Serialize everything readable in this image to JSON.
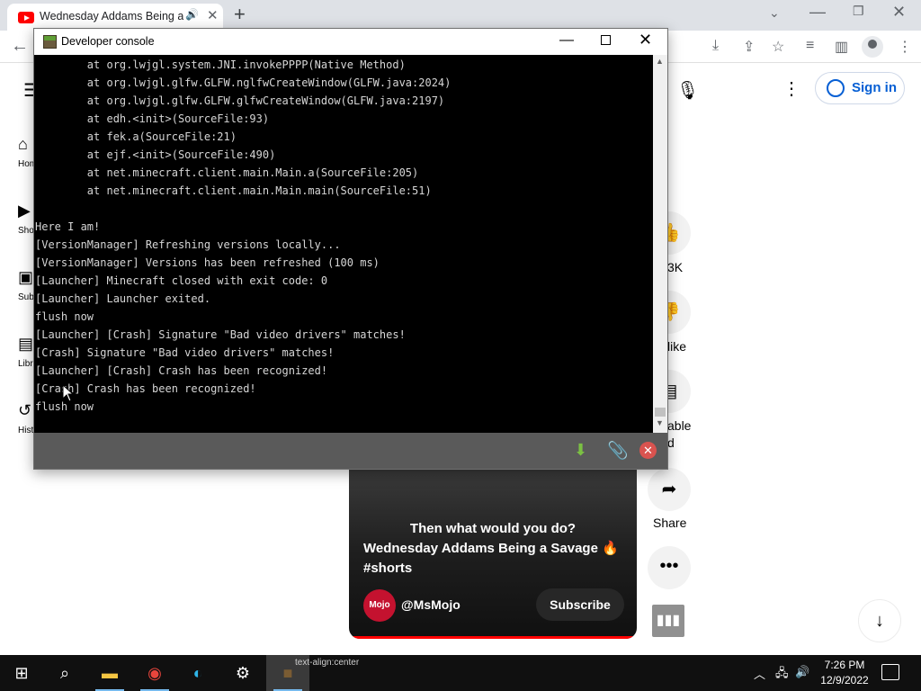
{
  "browser": {
    "tab_title": "Wednesday Addams Being a Savage",
    "new_tab_icon": "plus-icon"
  },
  "youtube": {
    "sign_in": "Sign in",
    "sidebar": [
      {
        "label": "Home",
        "icon": "home-icon"
      },
      {
        "label": "Shorts",
        "icon": "shorts-icon"
      },
      {
        "label": "Subscriptions",
        "icon": "subscriptions-icon"
      },
      {
        "label": "Library",
        "icon": "library-icon"
      },
      {
        "label": "History",
        "icon": "history-icon"
      }
    ],
    "actions": {
      "like_count": "3K",
      "dislike_label": "like",
      "disable_label": "able",
      "disable_sub": "d",
      "share_label": "Share"
    },
    "short": {
      "caption": "Then what would you do?",
      "title": "Wednesday Addams Being a Savage 🔥 #shorts",
      "channel_logo": "Mojo",
      "channel": "@MsMojo",
      "subscribe": "Subscribe"
    }
  },
  "dev_console": {
    "title": "Developer console",
    "lines": [
      "        at org.lwjgl.system.JNI.invokePPPP(Native Method)",
      "        at org.lwjgl.glfw.GLFW.nglfwCreateWindow(GLFW.java:2024)",
      "        at org.lwjgl.glfw.GLFW.glfwCreateWindow(GLFW.java:2197)",
      "        at edh.<init>(SourceFile:93)",
      "        at fek.a(SourceFile:21)",
      "        at ejf.<init>(SourceFile:490)",
      "        at net.minecraft.client.main.Main.a(SourceFile:205)",
      "        at net.minecraft.client.main.Main.main(SourceFile:51)",
      "",
      "Here I am!",
      "[VersionManager] Refreshing versions locally...",
      "[VersionManager] Versions has been refreshed (100 ms)",
      "[Launcher] Minecraft closed with exit code: 0",
      "[Launcher] Launcher exited.",
      "flush now",
      "[Launcher] [Crash] Signature \"Bad video drivers\" matches!",
      "[Crash] Signature \"Bad video drivers\" matches!",
      "[Launcher] [Crash] Crash has been recognized!",
      "[Crash] Crash has been recognized!",
      "flush now"
    ]
  },
  "taskbar": {
    "tooltip": "text-align:center",
    "time": "7:26 PM",
    "date": "12/9/2022"
  }
}
